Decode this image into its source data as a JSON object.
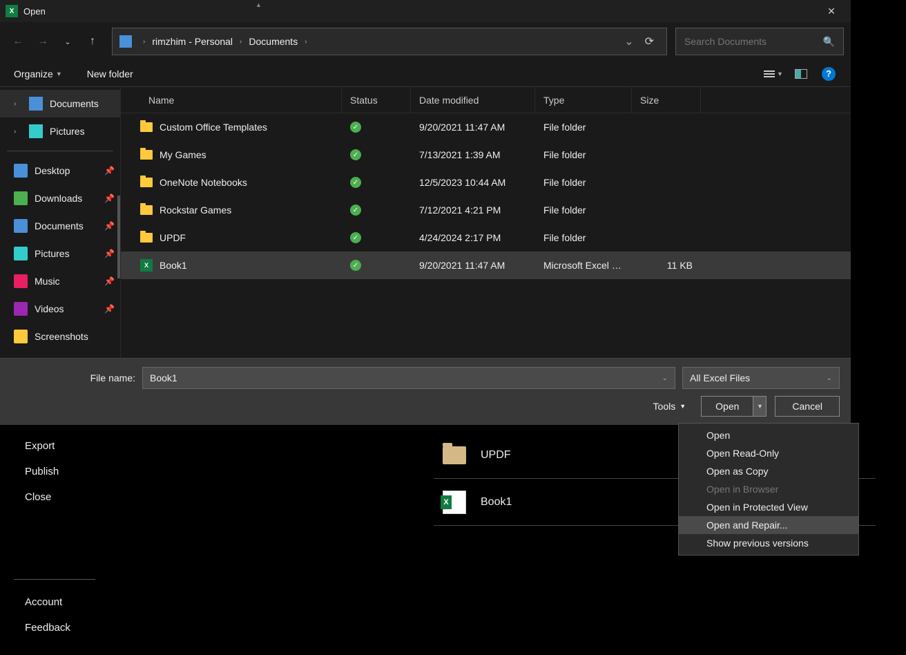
{
  "dialog": {
    "title": "Open",
    "breadcrumb": {
      "root": "rimzhim - Personal",
      "current": "Documents"
    },
    "search_placeholder": "Search Documents",
    "toolbar": {
      "organize": "Organize",
      "new_folder": "New folder"
    },
    "columns": {
      "name": "Name",
      "status": "Status",
      "date": "Date modified",
      "type": "Type",
      "size": "Size"
    },
    "sidebar_tree": [
      {
        "label": "Documents",
        "icon": "doc"
      },
      {
        "label": "Pictures",
        "icon": "pic"
      }
    ],
    "sidebar_quick": [
      {
        "label": "Desktop",
        "icon": "desktop",
        "pinned": true
      },
      {
        "label": "Downloads",
        "icon": "downloads",
        "pinned": true
      },
      {
        "label": "Documents",
        "icon": "documents",
        "pinned": true
      },
      {
        "label": "Pictures",
        "icon": "pictures",
        "pinned": true
      },
      {
        "label": "Music",
        "icon": "music",
        "pinned": true
      },
      {
        "label": "Videos",
        "icon": "videos",
        "pinned": true
      },
      {
        "label": "Screenshots",
        "icon": "folder",
        "pinned": false
      }
    ],
    "files": [
      {
        "name": "Custom Office Templates",
        "kind": "folder",
        "date": "9/20/2021 11:47 AM",
        "type": "File folder",
        "size": ""
      },
      {
        "name": "My Games",
        "kind": "folder",
        "date": "7/13/2021 1:39 AM",
        "type": "File folder",
        "size": ""
      },
      {
        "name": "OneNote Notebooks",
        "kind": "folder",
        "date": "12/5/2023 10:44 AM",
        "type": "File folder",
        "size": ""
      },
      {
        "name": "Rockstar Games",
        "kind": "folder",
        "date": "7/12/2021 4:21 PM",
        "type": "File folder",
        "size": ""
      },
      {
        "name": "UPDF",
        "kind": "folder",
        "date": "4/24/2024 2:17 PM",
        "type": "File folder",
        "size": ""
      },
      {
        "name": "Book1",
        "kind": "excel",
        "date": "9/20/2021 11:47 AM",
        "type": "Microsoft Excel W...",
        "size": "11 KB",
        "selected": true
      }
    ],
    "filename_label": "File name:",
    "filename_value": "Book1",
    "filter_value": "All Excel Files",
    "tools_label": "Tools",
    "open_label": "Open",
    "cancel_label": "Cancel",
    "open_menu": [
      {
        "label": "Open",
        "enabled": true
      },
      {
        "label": "Open Read-Only",
        "enabled": true
      },
      {
        "label": "Open as Copy",
        "enabled": true
      },
      {
        "label": "Open in Browser",
        "enabled": false
      },
      {
        "label": "Open in Protected View",
        "enabled": true
      },
      {
        "label": "Open and Repair...",
        "enabled": true,
        "hover": true
      },
      {
        "label": "Show previous versions",
        "enabled": true
      }
    ]
  },
  "backstage": {
    "left": [
      "Export",
      "Publish",
      "Close"
    ],
    "left_bottom": [
      "Account",
      "Feedback"
    ],
    "recent": [
      {
        "name": "UPDF",
        "kind": "folder"
      },
      {
        "name": "Book1",
        "kind": "excel"
      }
    ]
  }
}
